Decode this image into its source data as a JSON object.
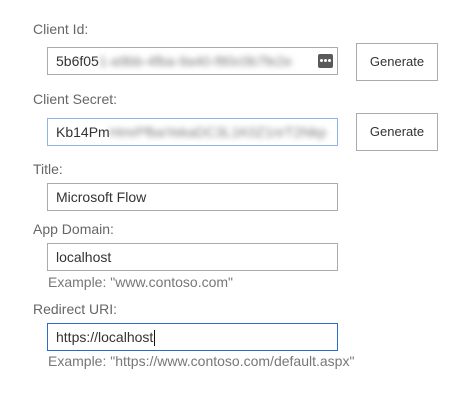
{
  "client_id": {
    "label": "Client Id:",
    "value_visible": "5b6f05",
    "value_obscured": "1-a9bb-4fba-9a40-f80c0b7fe2e",
    "button_label": "Generate",
    "field_icon": "more-dots-icon"
  },
  "client_secret": {
    "label": "Client Secret:",
    "value_visible": "Kb14Pm",
    "value_obscured": "HmrPfbaYekaDC3L1K0Z1nrT2Nkp",
    "button_label": "Generate"
  },
  "title": {
    "label": "Title:",
    "value": "Microsoft Flow"
  },
  "app_domain": {
    "label": "App Domain:",
    "value": "localhost",
    "hint": "Example: \"www.contoso.com\""
  },
  "redirect_uri": {
    "label": "Redirect URI:",
    "value": "https://localhost",
    "hint": "Example: \"https://www.contoso.com/default.aspx\""
  },
  "colors": {
    "focus_border": "#2b6ec8",
    "input_border": "#ababab",
    "label_text": "#666666"
  }
}
